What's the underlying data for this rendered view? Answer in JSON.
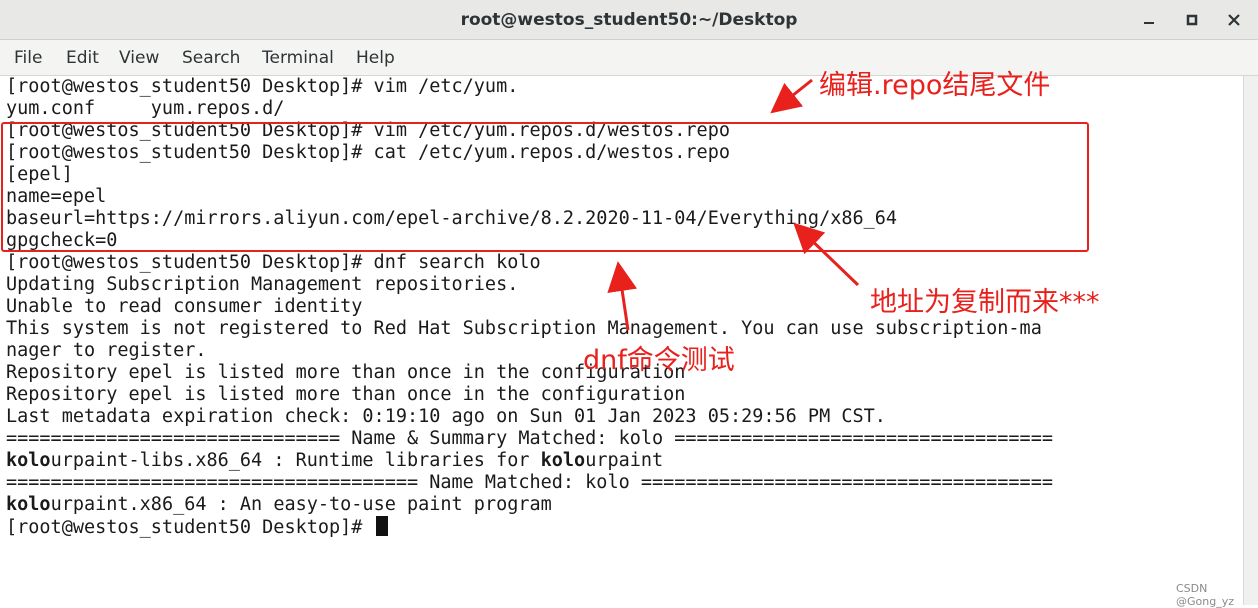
{
  "window": {
    "title": "root@westos_student50:~/Desktop"
  },
  "menu": {
    "file": "File",
    "edit": "Edit",
    "view": "View",
    "search": "Search",
    "terminal": "Terminal",
    "help": "Help"
  },
  "terminal": {
    "lines": [
      "[root@westos_student50 Desktop]# vim /etc/yum.",
      "yum.conf     yum.repos.d/",
      "[root@westos_student50 Desktop]# vim /etc/yum.repos.d/westos.repo",
      "[root@westos_student50 Desktop]# cat /etc/yum.repos.d/westos.repo",
      "[epel]",
      "name=epel",
      "baseurl=https://mirrors.aliyun.com/epel-archive/8.2.2020-11-04/Everything/x86_64",
      "gpgcheck=0",
      "[root@westos_student50 Desktop]# dnf search kolo",
      "Updating Subscription Management repositories.",
      "Unable to read consumer identity",
      "This system is not registered to Red Hat Subscription Management. You can use subscription-ma",
      "nager to register.",
      "Repository epel is listed more than once in the configuration",
      "Repository epel is listed more than once in the configuration",
      "Last metadata expiration check: 0:19:10 ago on Sun 01 Jan 2023 05:29:56 PM CST."
    ],
    "sep1": "============================== Name & Summary Matched: kolo ==================================",
    "result1_bold": "kolo",
    "result1_rest": "urpaint-libs.x86_64 : Runtime libraries for ",
    "result1_bold2": "kolo",
    "result1_tail": "urpaint",
    "sep2": "===================================== Name Matched: kolo =====================================",
    "result2_bold": "kolo",
    "result2_rest": "urpaint.x86_64 : An easy-to-use paint program",
    "prompt": "[root@westos_student50 Desktop]# "
  },
  "annotations": {
    "edit_repo": "编辑.repo结尾文件",
    "address_copied": "地址为复制而来***",
    "dnf_test": "dnf命令测试"
  },
  "watermark": "CSDN @Gong_yz",
  "colors": {
    "annotation": "#e8211d",
    "titlebar": "#e8e8e7",
    "terminal_bg": "#ffffff"
  }
}
